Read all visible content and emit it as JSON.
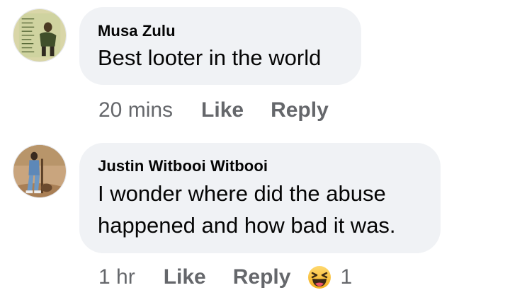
{
  "comments": [
    {
      "author": "Musa Zulu",
      "text_lines": [
        "Best looter in the world"
      ],
      "time": "20 mins",
      "like_label": "Like",
      "reply_label": "Reply"
    },
    {
      "author": "Justin Witbooi Witbooi",
      "text_lines": [
        "I wonder where did  the abuse",
        "happened and how bad it was."
      ],
      "time": "1 hr",
      "like_label": "Like",
      "reply_label": "Reply",
      "reaction": {
        "icon": "haha-emoji-icon",
        "count": "1"
      }
    }
  ],
  "colors": {
    "bubble_background": "#f0f2f5",
    "secondary_text": "#65676b",
    "primary_text": "#050505",
    "haha_yellow": "#f7b125"
  }
}
